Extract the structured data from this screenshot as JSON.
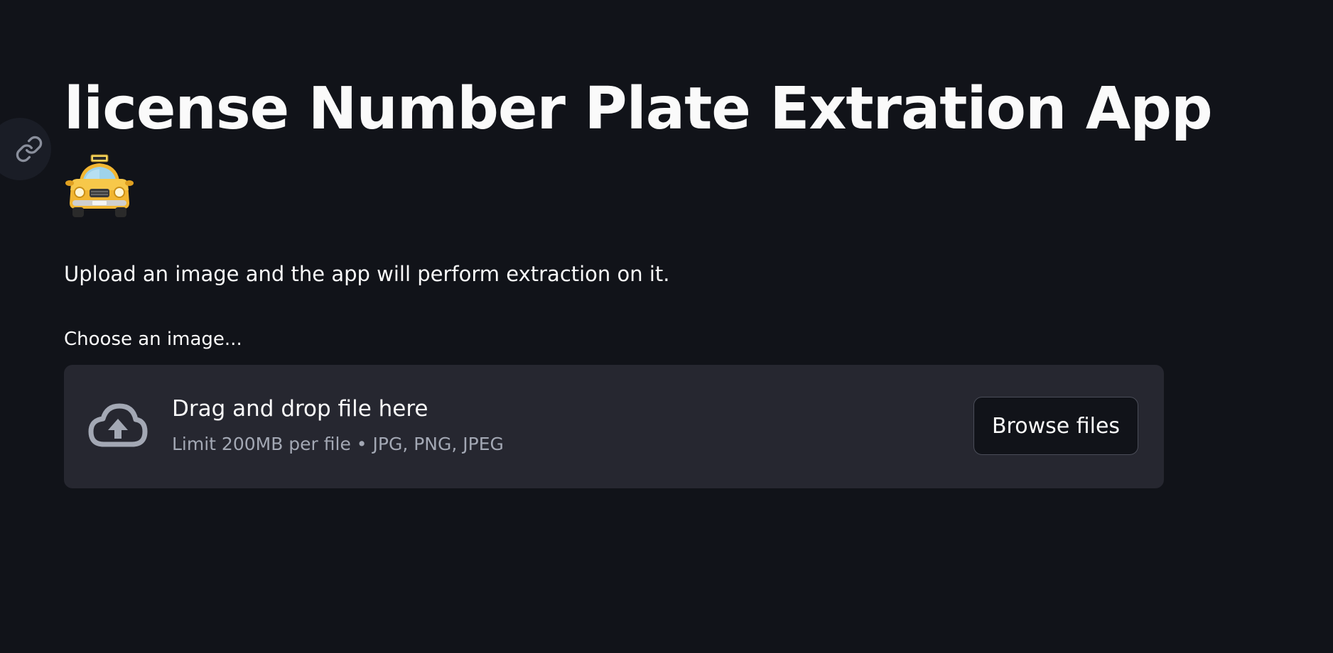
{
  "header": {
    "title": "license Number Plate Extration App",
    "title_emoji_icon": "taxi-icon",
    "anchor_icon": "link-icon"
  },
  "main": {
    "description": "Upload an image and the app will perform extraction on it.",
    "uploader": {
      "label": "Choose an image...",
      "icon": "cloud-upload-icon",
      "drop_text": "Drag and drop file here",
      "limit_text": "Limit 200MB per file • JPG, PNG, JPEG",
      "browse_label": "Browse files"
    }
  },
  "colors": {
    "background": "#111319",
    "dropzone": "#262730",
    "text": "#fafafa",
    "muted_text": "#a3a8b4",
    "taxi_yellow": "#f2b632"
  }
}
